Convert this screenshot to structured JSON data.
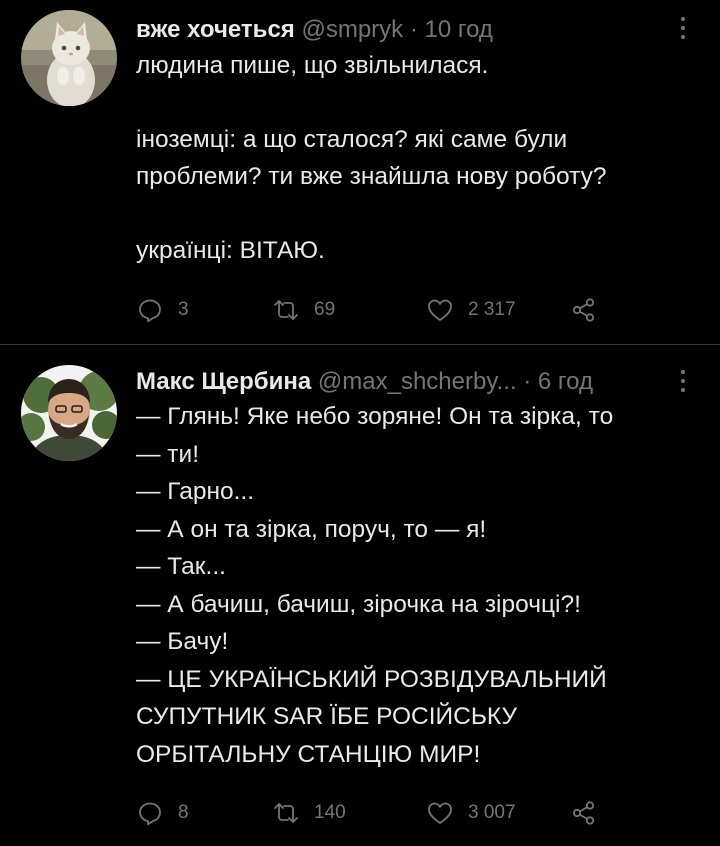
{
  "tweets": [
    {
      "name": "вже хочеться",
      "handle": "@smpryk",
      "separator": "·",
      "time": "10 год",
      "lines": [
        "людина пише, що звільнилася.",
        "",
        "іноземці: а що сталося? які саме були",
        "проблеми? ти вже знайшла нову роботу?",
        "",
        "українці: ВІТАЮ."
      ],
      "replies": "3",
      "retweets": "69",
      "likes": "2 317"
    },
    {
      "name": "Макс Щербина",
      "handle": "@max_shcherby...",
      "separator": "·",
      "time": "6 год",
      "lines": [
        "— Глянь! Яке небо зоряне! Он та зірка, то",
        "— ти!",
        "— Гарно...",
        "— А он та зірка, поруч, то — я!",
        "— Так...",
        "— А бачиш, бачиш, зірочка на зірочці?!",
        "— Бачу!",
        "— ЦЕ УКРАЇНСЬКИЙ РОЗВІДУВАЛЬНИЙ",
        "СУПУТНИК SAR ЇБЕ РОСІЙСЬКУ",
        "ОРБІТАЛЬНУ СТАНЦІЮ МИР!"
      ],
      "replies": "8",
      "retweets": "140",
      "likes": "3 007"
    }
  ],
  "icons": {
    "reply": "reply-icon",
    "retweet": "retweet-icon",
    "like": "heart-icon",
    "share": "share-icon",
    "more": "more-vertical-icon"
  },
  "colors": {
    "background": "#000000",
    "text": "#e7e9ea",
    "secondary": "#71767b",
    "divider": "#2f3336"
  }
}
